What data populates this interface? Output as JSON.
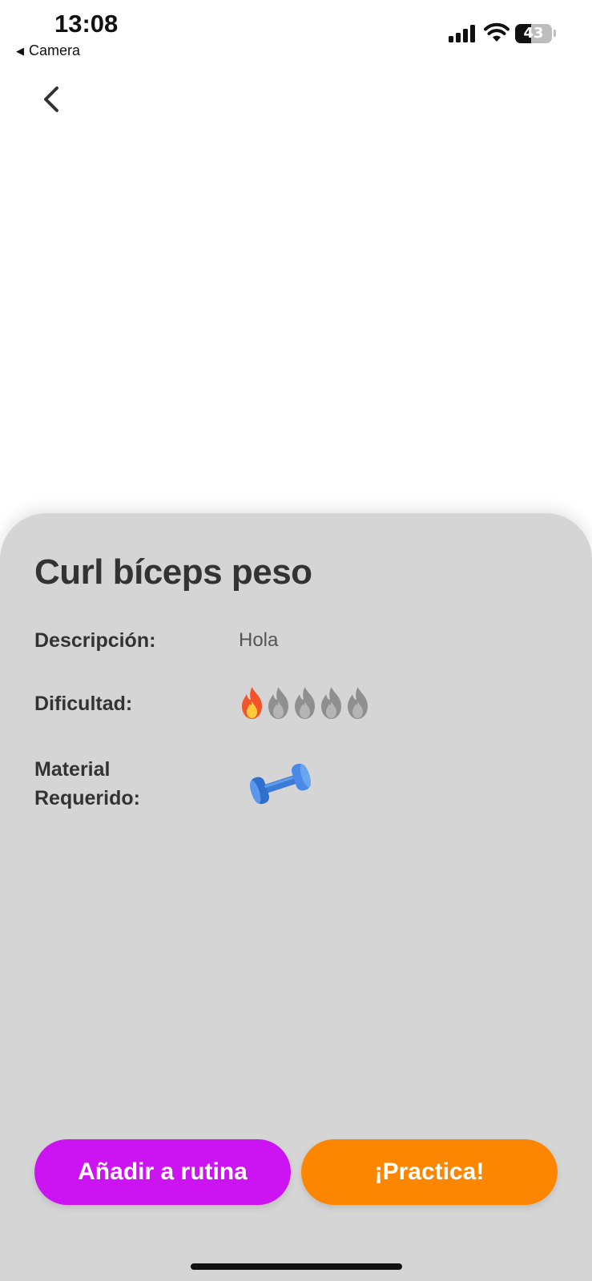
{
  "status_bar": {
    "time": "13:08",
    "back_app_label": "Camera",
    "battery_level": "43",
    "battery_fraction": 0.43
  },
  "exercise": {
    "title": "Curl bíceps peso",
    "description_label": "Descripción:",
    "description_value": "Hola",
    "difficulty_label": "Dificultad:",
    "difficulty_level": 1,
    "difficulty_max": 5,
    "material_label_line1": "Material",
    "material_label_line2": "Requerido:",
    "material_icon": "dumbbell-icon"
  },
  "actions": {
    "add_label": "Añadir a rutina",
    "practice_label": "¡Practica!"
  },
  "colors": {
    "add_button": "#cc14f2",
    "practice_button": "#fc8600",
    "sheet_background": "#d5d5d5"
  }
}
